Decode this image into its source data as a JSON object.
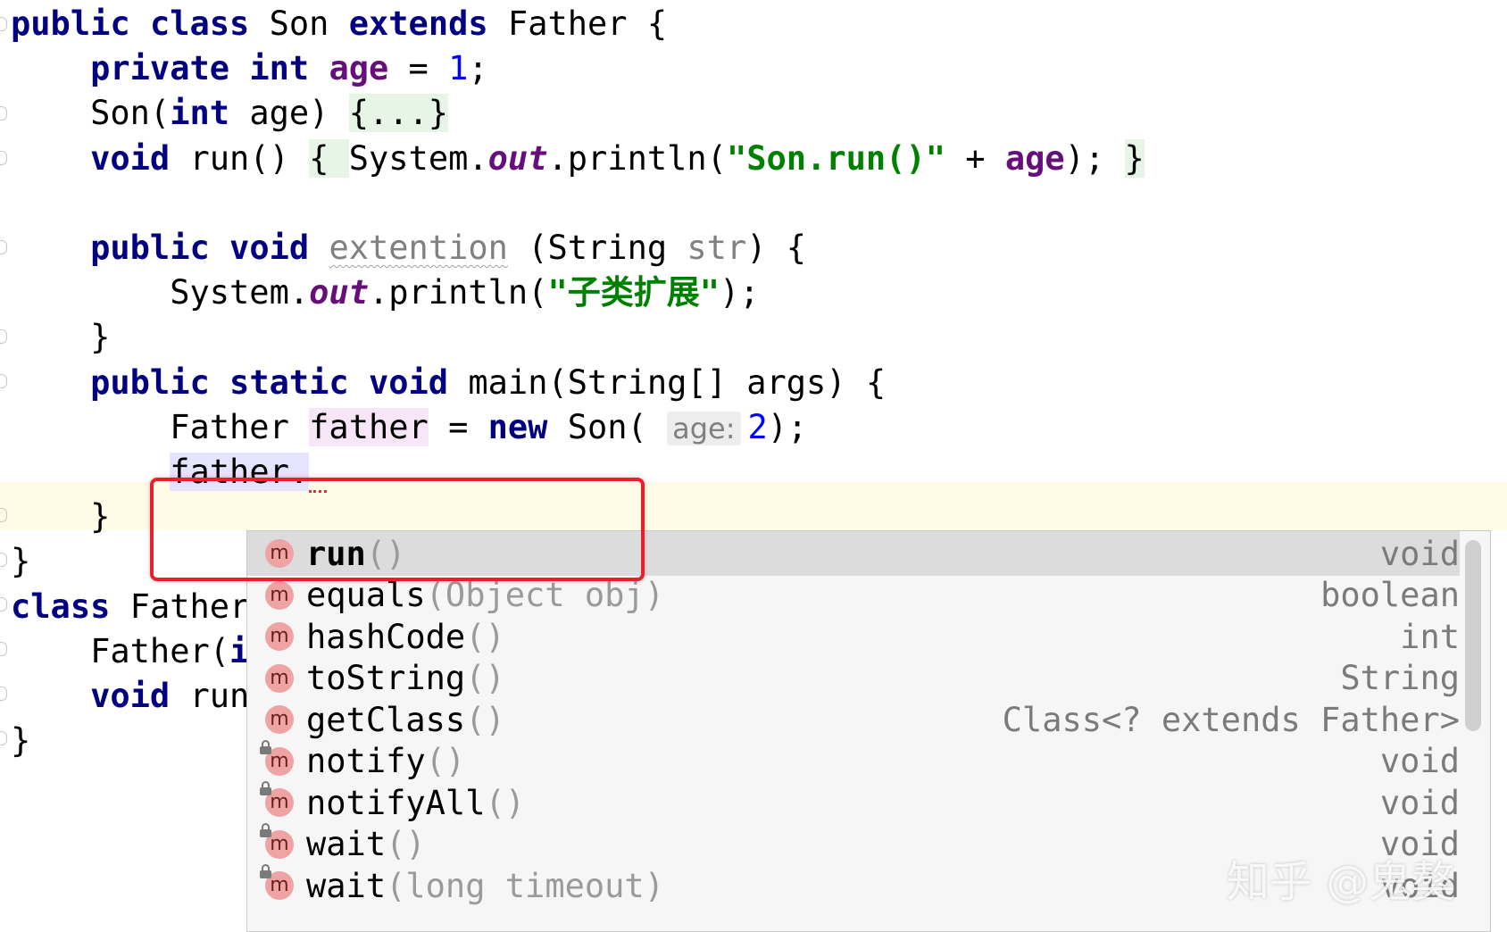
{
  "editor": {
    "lines": [
      {
        "segments": [
          {
            "t": "public",
            "c": "kw"
          },
          {
            "t": " "
          },
          {
            "t": "class",
            "c": "kw"
          },
          {
            "t": " Son "
          },
          {
            "t": "extends",
            "c": "kw"
          },
          {
            "t": " Father {"
          }
        ]
      },
      {
        "segments": [
          {
            "t": "    "
          },
          {
            "t": "private",
            "c": "kw"
          },
          {
            "t": " "
          },
          {
            "t": "int",
            "c": "kw"
          },
          {
            "t": " "
          },
          {
            "t": "age",
            "c": "field"
          },
          {
            "t": " = "
          },
          {
            "t": "1",
            "c": "num"
          },
          {
            "t": ";"
          }
        ]
      },
      {
        "segments": [
          {
            "t": "    Son("
          },
          {
            "t": "int",
            "c": "kw"
          },
          {
            "t": " age) "
          },
          {
            "t": "{...}",
            "c": "fold-bg"
          }
        ]
      },
      {
        "segments": [
          {
            "t": "    "
          },
          {
            "t": "void",
            "c": "kw"
          },
          {
            "t": " run() "
          },
          {
            "t": "{ ",
            "c": "fold-bg"
          },
          {
            "t": "System."
          },
          {
            "t": "out",
            "c": "static-field"
          },
          {
            "t": ".println("
          },
          {
            "t": "\"Son.run()\"",
            "c": "str"
          },
          {
            "t": " + "
          },
          {
            "t": "age",
            "c": "field"
          },
          {
            "t": "); "
          },
          {
            "t": "}",
            "c": "fold-bg"
          }
        ]
      },
      {
        "segments": []
      },
      {
        "segments": [
          {
            "t": "    "
          },
          {
            "t": "public",
            "c": "kw"
          },
          {
            "t": " "
          },
          {
            "t": "void",
            "c": "kw"
          },
          {
            "t": " "
          },
          {
            "t": "extention",
            "c": "unused-method"
          },
          {
            "t": " (String "
          },
          {
            "t": "str",
            "c": "param-unused"
          },
          {
            "t": ") {"
          }
        ]
      },
      {
        "segments": [
          {
            "t": "        System."
          },
          {
            "t": "out",
            "c": "static-field"
          },
          {
            "t": ".println("
          },
          {
            "t": "\"子类扩展\"",
            "c": "str"
          },
          {
            "t": ");"
          }
        ]
      },
      {
        "segments": [
          {
            "t": "    }"
          }
        ]
      },
      {
        "segments": [
          {
            "t": "    "
          },
          {
            "t": "public",
            "c": "kw"
          },
          {
            "t": " "
          },
          {
            "t": "static",
            "c": "kw"
          },
          {
            "t": " "
          },
          {
            "t": "void",
            "c": "kw"
          },
          {
            "t": " main(String[] args) {"
          }
        ]
      },
      {
        "segments": [
          {
            "t": "        Father "
          },
          {
            "t": "father",
            "c": "var-hl"
          },
          {
            "t": " = "
          },
          {
            "t": "new",
            "c": "kw"
          },
          {
            "t": " Son( "
          },
          {
            "t": "age:",
            "c": "hint"
          },
          {
            "t": "2",
            "c": "num"
          },
          {
            "t": ");"
          }
        ]
      },
      {
        "segments": [
          {
            "t": "        "
          },
          {
            "t": "father",
            "c": "sel-hl"
          },
          {
            "t": ".",
            "c": "sel-hl"
          },
          {
            "t": "",
            "c": "err-squiggle"
          }
        ]
      },
      {
        "segments": [
          {
            "t": "    }"
          }
        ]
      },
      {
        "segments": [
          {
            "t": "}"
          }
        ]
      },
      {
        "segments": [
          {
            "t": "class",
            "c": "kw"
          },
          {
            "t": " Father"
          }
        ]
      },
      {
        "segments": [
          {
            "t": "    Father("
          },
          {
            "t": "i",
            "c": "kw"
          }
        ]
      },
      {
        "segments": [
          {
            "t": "    "
          },
          {
            "t": "void",
            "c": "kw"
          },
          {
            "t": " run"
          }
        ]
      },
      {
        "segments": [
          {
            "t": "}"
          }
        ]
      }
    ]
  },
  "completion": {
    "icon_letter": "m",
    "icon_name": "method-icon",
    "items": [
      {
        "name": "run",
        "params": "()",
        "type": "void",
        "selected": true,
        "inherited": false
      },
      {
        "name": "equals",
        "params": "(Object obj)",
        "type": "boolean",
        "selected": false,
        "inherited": false
      },
      {
        "name": "hashCode",
        "params": "()",
        "type": "int",
        "selected": false,
        "inherited": false
      },
      {
        "name": "toString",
        "params": "()",
        "type": "String",
        "selected": false,
        "inherited": false
      },
      {
        "name": "getClass",
        "params": "()",
        "type": "Class<? extends Father>",
        "selected": false,
        "inherited": false
      },
      {
        "name": "notify",
        "params": "()",
        "type": "void",
        "selected": false,
        "inherited": true
      },
      {
        "name": "notifyAll",
        "params": "()",
        "type": "void",
        "selected": false,
        "inherited": true
      },
      {
        "name": "wait",
        "params": "()",
        "type": "void",
        "selected": false,
        "inherited": true
      },
      {
        "name": "wait",
        "params": "(long timeout)",
        "type": "void",
        "selected": false,
        "inherited": true
      }
    ]
  },
  "watermark": {
    "text": "知乎 @鬼獒"
  },
  "colors": {
    "keyword": "#000080",
    "field": "#660e7a",
    "string": "#008000",
    "number": "#0000ff",
    "highlight_box": "#e5212d",
    "current_line": "#fefbe6",
    "popup_selected": "#dcdcdc",
    "method_icon": "#f0a3a3"
  }
}
